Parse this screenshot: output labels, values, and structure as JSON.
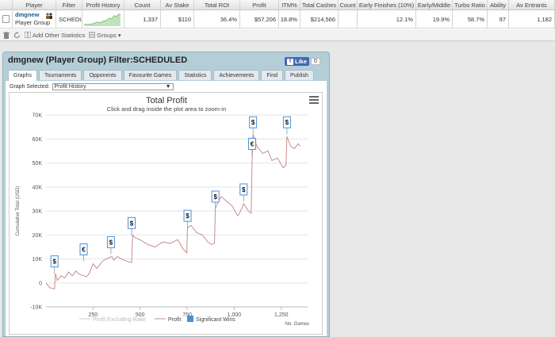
{
  "table": {
    "headers": [
      "Player",
      "Filter",
      "Profit History",
      "Count",
      "Av Stake",
      "Total ROI",
      "Profit",
      "ITM%",
      "Total Cashes",
      "Count",
      "Early Finishes (10%)",
      "Early/Middle",
      "Turbo Ratio",
      "Ability",
      "Av Entrants"
    ],
    "row": {
      "player_name": "dmgnew",
      "player_type": "Player Group",
      "filter": "SCHEDU",
      "count": "1,337",
      "av_stake": "$110",
      "total_roi": "36.4%",
      "profit": "$57,206",
      "itm": "18.8%",
      "total_cashes": "$214,566",
      "count2": "",
      "early_finishes": "12.1%",
      "early_middle": "19.9%",
      "turbo_ratio": "58.7%",
      "ability": "97",
      "av_entrants": "1,182"
    }
  },
  "toolbar": {
    "add_stats": "Add Other Statistics",
    "groups": "Groups"
  },
  "panel": {
    "title": "dmgnew (Player Group) Filter:SCHEDULED",
    "fb_like": "Like",
    "fb_count": "0",
    "tabs": [
      "Graphs",
      "Tournaments",
      "Opponents",
      "Favourite Games",
      "Statistics",
      "Achievements",
      "Find",
      "Publish"
    ],
    "graph_selected_label": "Graph Selected:",
    "graph_selected_value": "Profit History"
  },
  "chart_data": {
    "type": "line",
    "title": "Total Profit",
    "subtitle": "Click and drag inside the plot area to zoom-in",
    "ylabel": "Cumulative Total (USD)",
    "xlabel": "No. Games",
    "ylim": [
      -10000,
      70000
    ],
    "xlim": [
      0,
      1390
    ],
    "y_ticks": [
      -10000,
      0,
      10000,
      20000,
      30000,
      40000,
      50000,
      60000,
      70000
    ],
    "y_tick_labels": [
      "-10K",
      "0",
      "10K",
      "20K",
      "30K",
      "40K",
      "50K",
      "60K",
      "70K"
    ],
    "x_ticks": [
      250,
      500,
      750,
      1000,
      1250
    ],
    "x_tick_labels": [
      "250",
      "500",
      "750",
      "1,000",
      "1,250"
    ],
    "legend": [
      "Profit Excluding Rake",
      "Profit",
      "Significant Wins"
    ],
    "colors": {
      "profit": "#c98d8d",
      "excl_rake": "#cccccc",
      "flag": "#4a90d9"
    },
    "series": [
      {
        "name": "Profit",
        "x": [
          0,
          20,
          45,
          50,
          60,
          80,
          100,
          120,
          140,
          160,
          170,
          180,
          200,
          215,
          230,
          250,
          270,
          300,
          320,
          350,
          360,
          380,
          400,
          430,
          455,
          460,
          470,
          500,
          540,
          580,
          620,
          660,
          700,
          730,
          748,
          752,
          770,
          800,
          830,
          860,
          880,
          895,
          900,
          910,
          930,
          960,
          990,
          1010,
          1020,
          1040,
          1050,
          1060,
          1075,
          1090,
          1095,
          1100,
          1120,
          1150,
          1180,
          1200,
          1230,
          1260,
          1275,
          1280,
          1300,
          1320,
          1340,
          1350
        ],
        "y": [
          0,
          -2000,
          -2500,
          4000,
          1000,
          3000,
          2000,
          4500,
          3000,
          5000,
          4000,
          3500,
          3000,
          2500,
          4000,
          8000,
          6000,
          9000,
          10000,
          11000,
          9500,
          11000,
          10000,
          9000,
          8500,
          20000,
          19000,
          18000,
          16000,
          15000,
          17000,
          16500,
          18000,
          14000,
          12500,
          23000,
          24000,
          21000,
          20000,
          17000,
          16000,
          16500,
          31000,
          33000,
          36000,
          34000,
          32000,
          29000,
          28000,
          31000,
          33000,
          32000,
          30000,
          29000,
          51000,
          62000,
          57000,
          54000,
          55000,
          51000,
          52000,
          48000,
          49000,
          61000,
          57000,
          56000,
          58000,
          57000
        ]
      }
    ],
    "significant_wins": [
      {
        "x": 45,
        "y": 4000,
        "currency": "$"
      },
      {
        "x": 200,
        "y": 9000,
        "currency": "€"
      },
      {
        "x": 345,
        "y": 12000,
        "currency": "$"
      },
      {
        "x": 455,
        "y": 20000,
        "currency": "$"
      },
      {
        "x": 752,
        "y": 23000,
        "currency": "$"
      },
      {
        "x": 900,
        "y": 31000,
        "currency": "$"
      },
      {
        "x": 1050,
        "y": 34000,
        "currency": "$"
      },
      {
        "x": 1095,
        "y": 53000,
        "currency": "€"
      },
      {
        "x": 1100,
        "y": 62000,
        "currency": "$"
      },
      {
        "x": 1280,
        "y": 62000,
        "currency": "$"
      }
    ]
  }
}
